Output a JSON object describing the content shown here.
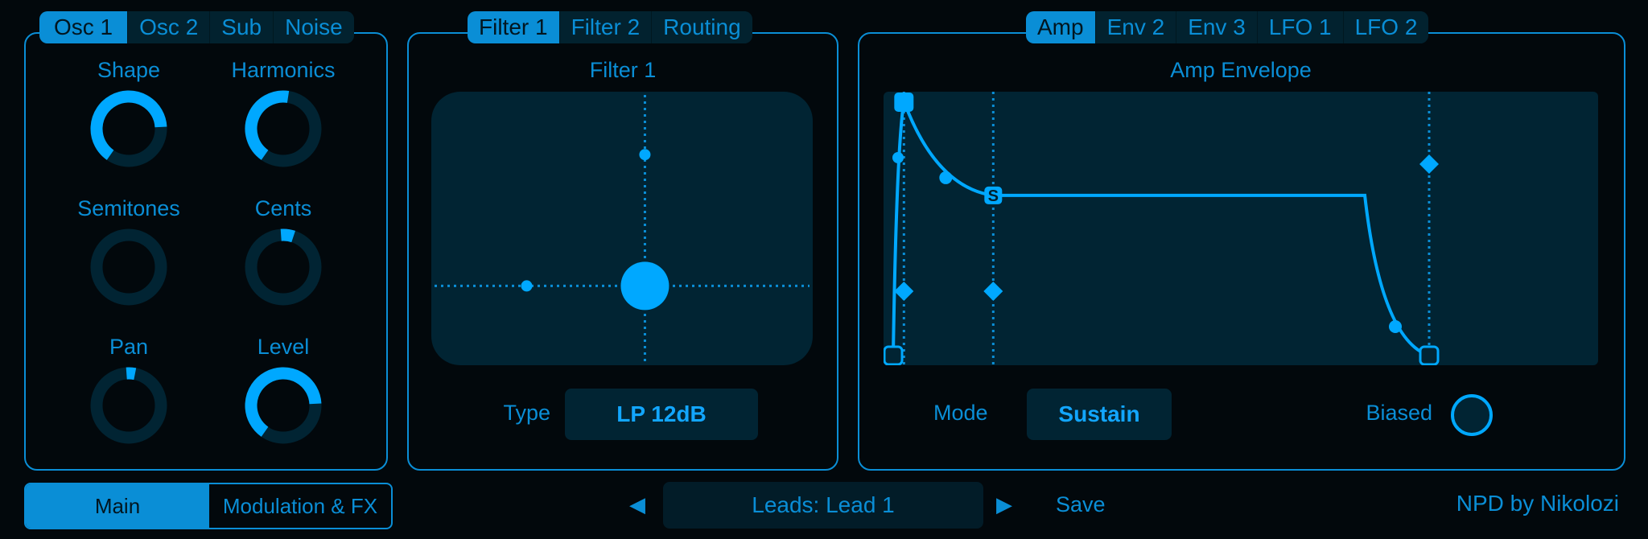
{
  "colors": {
    "accent": "#0a8ed6",
    "bright": "#00a8ff",
    "track": "#012433",
    "background": "#02080c"
  },
  "osc_panel": {
    "tabs": [
      {
        "label": "Osc 1",
        "active": true
      },
      {
        "label": "Osc 2",
        "active": false
      },
      {
        "label": "Sub",
        "active": false
      },
      {
        "label": "Noise",
        "active": false
      }
    ],
    "knobs": [
      {
        "label": "Shape",
        "value": 0.8,
        "mode": "unipolar"
      },
      {
        "label": "Harmonics",
        "value": 0.53,
        "mode": "unipolar"
      },
      {
        "label": "Semitones",
        "value": 0.0,
        "mode": "bipolar"
      },
      {
        "label": "Cents",
        "value": 0.04,
        "mode": "bipolar"
      },
      {
        "label": "Pan",
        "value": 0.02,
        "mode": "bipolar"
      },
      {
        "label": "Level",
        "value": 0.8,
        "mode": "unipolar"
      }
    ]
  },
  "filter_panel": {
    "tabs": [
      {
        "label": "Filter 1",
        "active": true
      },
      {
        "label": "Filter 2",
        "active": false
      },
      {
        "label": "Routing",
        "active": false
      }
    ],
    "title": "Filter 1",
    "xy_pad": {
      "cutoff": 0.56,
      "resonance": 0.29,
      "x_mod_handle": 0.25,
      "y_mod_handle": 0.77
    },
    "type_label": "Type",
    "type_value": "LP 12dB"
  },
  "env_panel": {
    "tabs": [
      {
        "label": "Amp",
        "active": true
      },
      {
        "label": "Env 2",
        "active": false
      },
      {
        "label": "Env 3",
        "active": false
      },
      {
        "label": "LFO 1",
        "active": false
      },
      {
        "label": "LFO 2",
        "active": false
      }
    ],
    "title": "Amp Envelope",
    "sustain_marker": "S",
    "envelope": {
      "attack": 0.015,
      "decay": 0.14,
      "sustain": 0.63,
      "release_start": 0.66,
      "release_end": 0.75
    },
    "mode_label": "Mode",
    "mode_value": "Sustain",
    "biased_label": "Biased",
    "biased_on": false
  },
  "footer": {
    "view_tabs": [
      {
        "label": "Main",
        "active": true
      },
      {
        "label": "Modulation & FX",
        "active": false
      }
    ],
    "preset_name": "Leads: Lead 1",
    "prev_icon": "◀",
    "next_icon": "▶",
    "save_label": "Save",
    "brand": "NPD by Nikolozi"
  }
}
